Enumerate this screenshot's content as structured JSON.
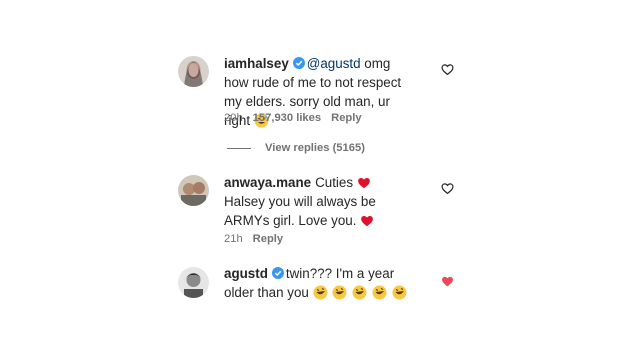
{
  "comments": [
    {
      "username": "iamhalsey",
      "mention": "@agustd",
      "text": " omg how rude of me to not respect my elders. sorry old man, ur right",
      "time": "20h",
      "likes": "157,930 likes",
      "reply": "Reply",
      "liked": false
    },
    {
      "username": "anwaya.mane",
      "text_before": "Cuties",
      "text_after": " Halsey you will always be ARMYs girl. Love you.",
      "time": "21h",
      "reply": "Reply",
      "liked": false
    },
    {
      "username": "agustd",
      "text": "twin??? I'm a year older than you",
      "liked": true
    }
  ],
  "view_replies": "View replies (5165)",
  "colors": {
    "like_active": "#ed4956",
    "verified": "#3897f0",
    "meta": "#737373"
  }
}
